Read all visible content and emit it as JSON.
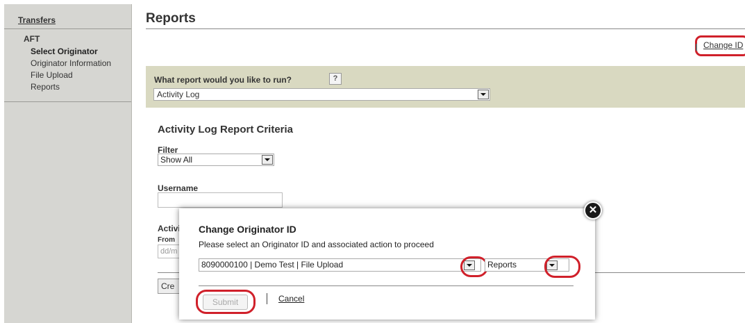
{
  "sidebar": {
    "title": "Transfers",
    "section": "AFT",
    "items": [
      {
        "label": "Select Originator"
      },
      {
        "label": "Originator Information"
      },
      {
        "label": "File Upload"
      },
      {
        "label": "Reports"
      }
    ]
  },
  "main": {
    "page_title": "Reports",
    "change_id_label": "Change ID",
    "question_label": "What report would you like to run?",
    "help_label": "?",
    "report_selected": "Activity Log",
    "criteria_title": "Activity Log Report Criteria",
    "filter_label": "Filter",
    "filter_selected": "Show All",
    "username_label": "Username",
    "activity_label_partial": "Activi",
    "from_label": "From",
    "from_placeholder": "dd/m",
    "create_button_partial": "Cre"
  },
  "modal": {
    "title": "Change Originator ID",
    "description": "Please select an Originator ID and associated action to proceed",
    "originator_selected": "8090000100 | Demo Test | File Upload",
    "action_selected": "Reports",
    "submit_label": "Submit",
    "cancel_label": "Cancel"
  },
  "colors": {
    "highlight": "#d0202a",
    "question_bg": "#d9d9c1",
    "sidebar_bg": "#d6d6d2"
  }
}
